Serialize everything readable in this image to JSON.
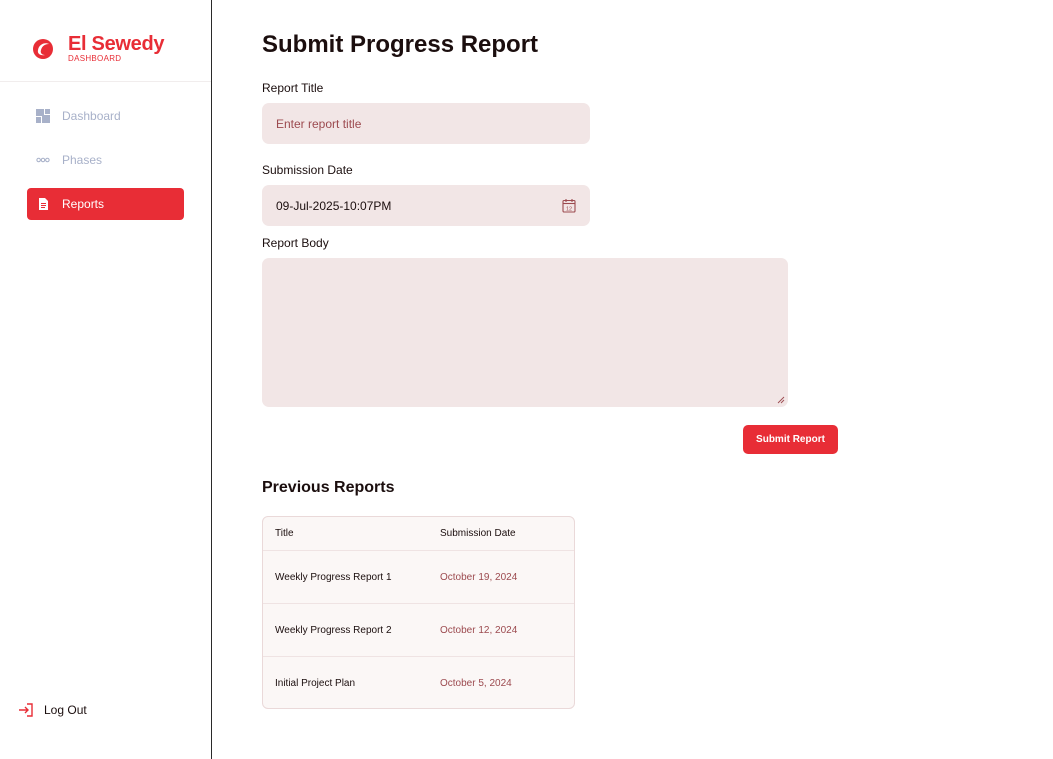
{
  "sidebar": {
    "brand_name": "El Sewedy",
    "brand_sub": "DASHBOARD",
    "items": [
      {
        "label": "Dashboard",
        "icon": "grid-icon",
        "active": false
      },
      {
        "label": "Phases",
        "icon": "dots-icon",
        "active": false
      },
      {
        "label": "Reports",
        "icon": "document-icon",
        "active": true
      }
    ],
    "logout_label": "Log Out"
  },
  "main": {
    "title": "Submit Progress Report",
    "report_title_label": "Report Title",
    "report_title_placeholder": "Enter report title",
    "submission_date_label": "Submission Date",
    "submission_date_value": "09-Jul-2025-10:07PM",
    "report_body_label": "Report Body",
    "submit_label": "Submit Report"
  },
  "previous": {
    "title": "Previous Reports",
    "columns": [
      "Title",
      "Submission Date"
    ],
    "rows": [
      {
        "title": "Weekly Progress Report 1",
        "date": "October 19, 2024"
      },
      {
        "title": "Weekly Progress Report 2",
        "date": "October 12, 2024"
      },
      {
        "title": "Initial Project Plan",
        "date": "October 5, 2024"
      }
    ]
  },
  "colors": {
    "accent": "#e82d36",
    "field_bg": "#f2e6e6",
    "muted_red": "#9c4a4f",
    "nav_inactive": "#a8b1c9"
  }
}
